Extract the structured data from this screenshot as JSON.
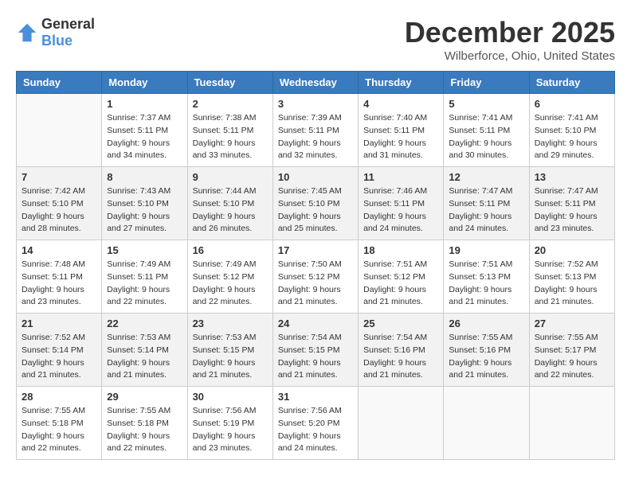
{
  "header": {
    "logo_general": "General",
    "logo_blue": "Blue",
    "month": "December 2025",
    "location": "Wilberforce, Ohio, United States"
  },
  "days_of_week": [
    "Sunday",
    "Monday",
    "Tuesday",
    "Wednesday",
    "Thursday",
    "Friday",
    "Saturday"
  ],
  "weeks": [
    [
      {
        "day": "",
        "sunrise": "",
        "sunset": "",
        "daylight": ""
      },
      {
        "day": "1",
        "sunrise": "Sunrise: 7:37 AM",
        "sunset": "Sunset: 5:11 PM",
        "daylight": "Daylight: 9 hours and 34 minutes."
      },
      {
        "day": "2",
        "sunrise": "Sunrise: 7:38 AM",
        "sunset": "Sunset: 5:11 PM",
        "daylight": "Daylight: 9 hours and 33 minutes."
      },
      {
        "day": "3",
        "sunrise": "Sunrise: 7:39 AM",
        "sunset": "Sunset: 5:11 PM",
        "daylight": "Daylight: 9 hours and 32 minutes."
      },
      {
        "day": "4",
        "sunrise": "Sunrise: 7:40 AM",
        "sunset": "Sunset: 5:11 PM",
        "daylight": "Daylight: 9 hours and 31 minutes."
      },
      {
        "day": "5",
        "sunrise": "Sunrise: 7:41 AM",
        "sunset": "Sunset: 5:11 PM",
        "daylight": "Daylight: 9 hours and 30 minutes."
      },
      {
        "day": "6",
        "sunrise": "Sunrise: 7:41 AM",
        "sunset": "Sunset: 5:10 PM",
        "daylight": "Daylight: 9 hours and 29 minutes."
      }
    ],
    [
      {
        "day": "7",
        "sunrise": "Sunrise: 7:42 AM",
        "sunset": "Sunset: 5:10 PM",
        "daylight": "Daylight: 9 hours and 28 minutes."
      },
      {
        "day": "8",
        "sunrise": "Sunrise: 7:43 AM",
        "sunset": "Sunset: 5:10 PM",
        "daylight": "Daylight: 9 hours and 27 minutes."
      },
      {
        "day": "9",
        "sunrise": "Sunrise: 7:44 AM",
        "sunset": "Sunset: 5:10 PM",
        "daylight": "Daylight: 9 hours and 26 minutes."
      },
      {
        "day": "10",
        "sunrise": "Sunrise: 7:45 AM",
        "sunset": "Sunset: 5:10 PM",
        "daylight": "Daylight: 9 hours and 25 minutes."
      },
      {
        "day": "11",
        "sunrise": "Sunrise: 7:46 AM",
        "sunset": "Sunset: 5:11 PM",
        "daylight": "Daylight: 9 hours and 24 minutes."
      },
      {
        "day": "12",
        "sunrise": "Sunrise: 7:47 AM",
        "sunset": "Sunset: 5:11 PM",
        "daylight": "Daylight: 9 hours and 24 minutes."
      },
      {
        "day": "13",
        "sunrise": "Sunrise: 7:47 AM",
        "sunset": "Sunset: 5:11 PM",
        "daylight": "Daylight: 9 hours and 23 minutes."
      }
    ],
    [
      {
        "day": "14",
        "sunrise": "Sunrise: 7:48 AM",
        "sunset": "Sunset: 5:11 PM",
        "daylight": "Daylight: 9 hours and 23 minutes."
      },
      {
        "day": "15",
        "sunrise": "Sunrise: 7:49 AM",
        "sunset": "Sunset: 5:11 PM",
        "daylight": "Daylight: 9 hours and 22 minutes."
      },
      {
        "day": "16",
        "sunrise": "Sunrise: 7:49 AM",
        "sunset": "Sunset: 5:12 PM",
        "daylight": "Daylight: 9 hours and 22 minutes."
      },
      {
        "day": "17",
        "sunrise": "Sunrise: 7:50 AM",
        "sunset": "Sunset: 5:12 PM",
        "daylight": "Daylight: 9 hours and 21 minutes."
      },
      {
        "day": "18",
        "sunrise": "Sunrise: 7:51 AM",
        "sunset": "Sunset: 5:12 PM",
        "daylight": "Daylight: 9 hours and 21 minutes."
      },
      {
        "day": "19",
        "sunrise": "Sunrise: 7:51 AM",
        "sunset": "Sunset: 5:13 PM",
        "daylight": "Daylight: 9 hours and 21 minutes."
      },
      {
        "day": "20",
        "sunrise": "Sunrise: 7:52 AM",
        "sunset": "Sunset: 5:13 PM",
        "daylight": "Daylight: 9 hours and 21 minutes."
      }
    ],
    [
      {
        "day": "21",
        "sunrise": "Sunrise: 7:52 AM",
        "sunset": "Sunset: 5:14 PM",
        "daylight": "Daylight: 9 hours and 21 minutes."
      },
      {
        "day": "22",
        "sunrise": "Sunrise: 7:53 AM",
        "sunset": "Sunset: 5:14 PM",
        "daylight": "Daylight: 9 hours and 21 minutes."
      },
      {
        "day": "23",
        "sunrise": "Sunrise: 7:53 AM",
        "sunset": "Sunset: 5:15 PM",
        "daylight": "Daylight: 9 hours and 21 minutes."
      },
      {
        "day": "24",
        "sunrise": "Sunrise: 7:54 AM",
        "sunset": "Sunset: 5:15 PM",
        "daylight": "Daylight: 9 hours and 21 minutes."
      },
      {
        "day": "25",
        "sunrise": "Sunrise: 7:54 AM",
        "sunset": "Sunset: 5:16 PM",
        "daylight": "Daylight: 9 hours and 21 minutes."
      },
      {
        "day": "26",
        "sunrise": "Sunrise: 7:55 AM",
        "sunset": "Sunset: 5:16 PM",
        "daylight": "Daylight: 9 hours and 21 minutes."
      },
      {
        "day": "27",
        "sunrise": "Sunrise: 7:55 AM",
        "sunset": "Sunset: 5:17 PM",
        "daylight": "Daylight: 9 hours and 22 minutes."
      }
    ],
    [
      {
        "day": "28",
        "sunrise": "Sunrise: 7:55 AM",
        "sunset": "Sunset: 5:18 PM",
        "daylight": "Daylight: 9 hours and 22 minutes."
      },
      {
        "day": "29",
        "sunrise": "Sunrise: 7:55 AM",
        "sunset": "Sunset: 5:18 PM",
        "daylight": "Daylight: 9 hours and 22 minutes."
      },
      {
        "day": "30",
        "sunrise": "Sunrise: 7:56 AM",
        "sunset": "Sunset: 5:19 PM",
        "daylight": "Daylight: 9 hours and 23 minutes."
      },
      {
        "day": "31",
        "sunrise": "Sunrise: 7:56 AM",
        "sunset": "Sunset: 5:20 PM",
        "daylight": "Daylight: 9 hours and 24 minutes."
      },
      {
        "day": "",
        "sunrise": "",
        "sunset": "",
        "daylight": ""
      },
      {
        "day": "",
        "sunrise": "",
        "sunset": "",
        "daylight": ""
      },
      {
        "day": "",
        "sunrise": "",
        "sunset": "",
        "daylight": ""
      }
    ]
  ]
}
